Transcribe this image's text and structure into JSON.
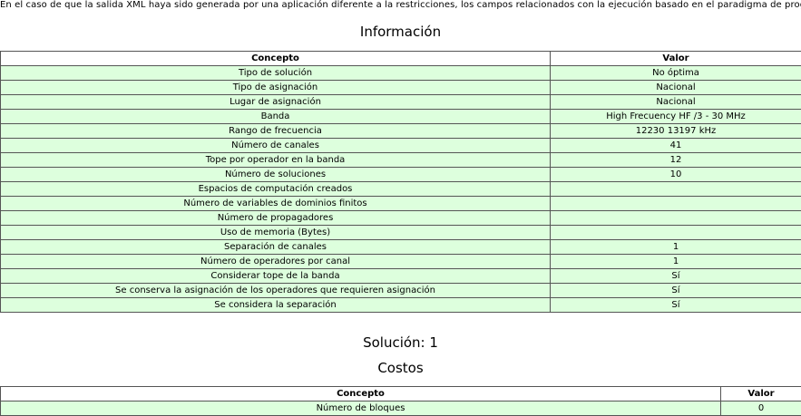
{
  "notice": "En el caso de que la salida XML haya sido generada por una aplicación diferente a la restricciones, los campos relacionados con la ejecución basado en el paradigma de programación",
  "info_title": "Información",
  "info_table": {
    "headers": [
      "Concepto",
      "Valor"
    ],
    "rows": [
      [
        "Tipo de solución",
        "No óptima"
      ],
      [
        "Tipo de asignación",
        "Nacional"
      ],
      [
        "Lugar de asignación",
        "Nacional"
      ],
      [
        "Banda",
        "High Frecuency HF /3 - 30 MHz"
      ],
      [
        "Rango de frecuencia",
        "12230 13197 kHz"
      ],
      [
        "Número de canales",
        "41"
      ],
      [
        "Tope por operador en la banda",
        "12"
      ],
      [
        "Número de soluciones",
        "10"
      ],
      [
        "Espacios de computación creados",
        ""
      ],
      [
        "Número de variables de dominios finitos",
        ""
      ],
      [
        "Número de propagadores",
        ""
      ],
      [
        "Uso de memoria (Bytes)",
        ""
      ],
      [
        "Separación de canales",
        "1"
      ],
      [
        "Número de operadores por canal",
        "1"
      ],
      [
        "Considerar tope de la banda",
        "Sí"
      ],
      [
        "Se conserva la asignación de los operadores que requieren asignación",
        "Sí"
      ],
      [
        "Se considera la separación",
        "Sí"
      ]
    ]
  },
  "solution_title": "Solución: 1",
  "costs_title": "Costos",
  "costs_table": {
    "headers": [
      "Concepto",
      "Valor"
    ],
    "rows": [
      [
        "Número de bloques",
        "0"
      ]
    ]
  }
}
